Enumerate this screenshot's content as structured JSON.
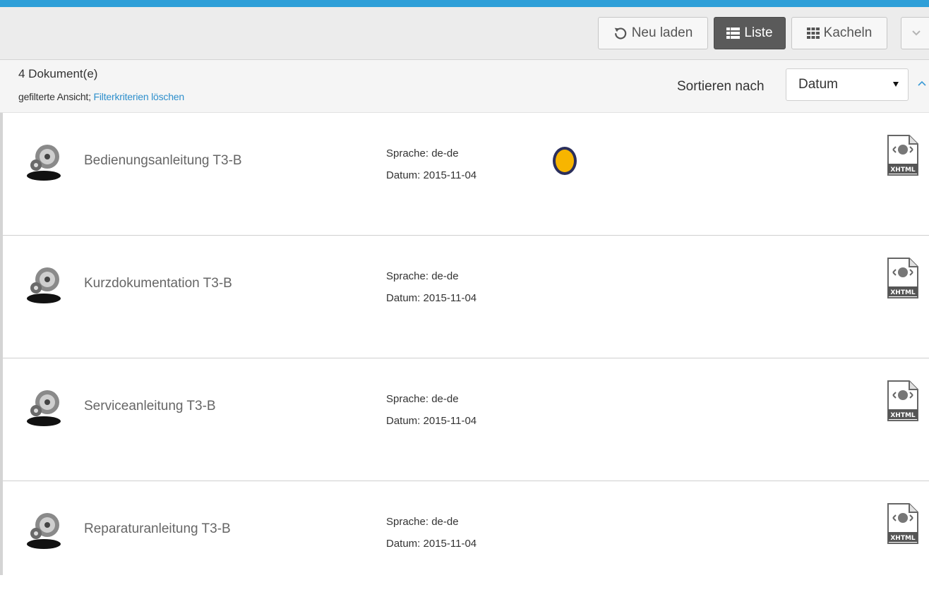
{
  "colors": {
    "accent": "#2e9fd8",
    "active_button": "#5a5a5a",
    "link": "#2e8fcc"
  },
  "toolbar": {
    "reload_label": "Neu laden",
    "list_label": "Liste",
    "tiles_label": "Kacheln",
    "active_view": "Liste"
  },
  "info": {
    "count": "4 Dokument(e)",
    "filtered_text": "gefilterte Ansicht;",
    "clear_filter_link": "Filterkriterien löschen",
    "sort_label": "Sortieren nach",
    "sort_value": "Datum"
  },
  "documents": [
    {
      "title": "Bedienungsanleitung T3-B",
      "language": "Sprache: de-de",
      "date": "Datum: 2015-11-04",
      "format_icon": "xhtml-file-icon"
    },
    {
      "title": "Kurzdokumentation T3-B",
      "language": "Sprache: de-de",
      "date": "Datum: 2015-11-04",
      "format_icon": "xhtml-file-icon"
    },
    {
      "title": "Serviceanleitung T3-B",
      "language": "Sprache: de-de",
      "date": "Datum: 2015-11-04",
      "format_icon": "xhtml-file-icon"
    },
    {
      "title": "Reparaturanleitung T3-B",
      "language": "Sprache: de-de",
      "date": "Datum: 2015-11-04",
      "format_icon": "xhtml-file-icon"
    }
  ]
}
